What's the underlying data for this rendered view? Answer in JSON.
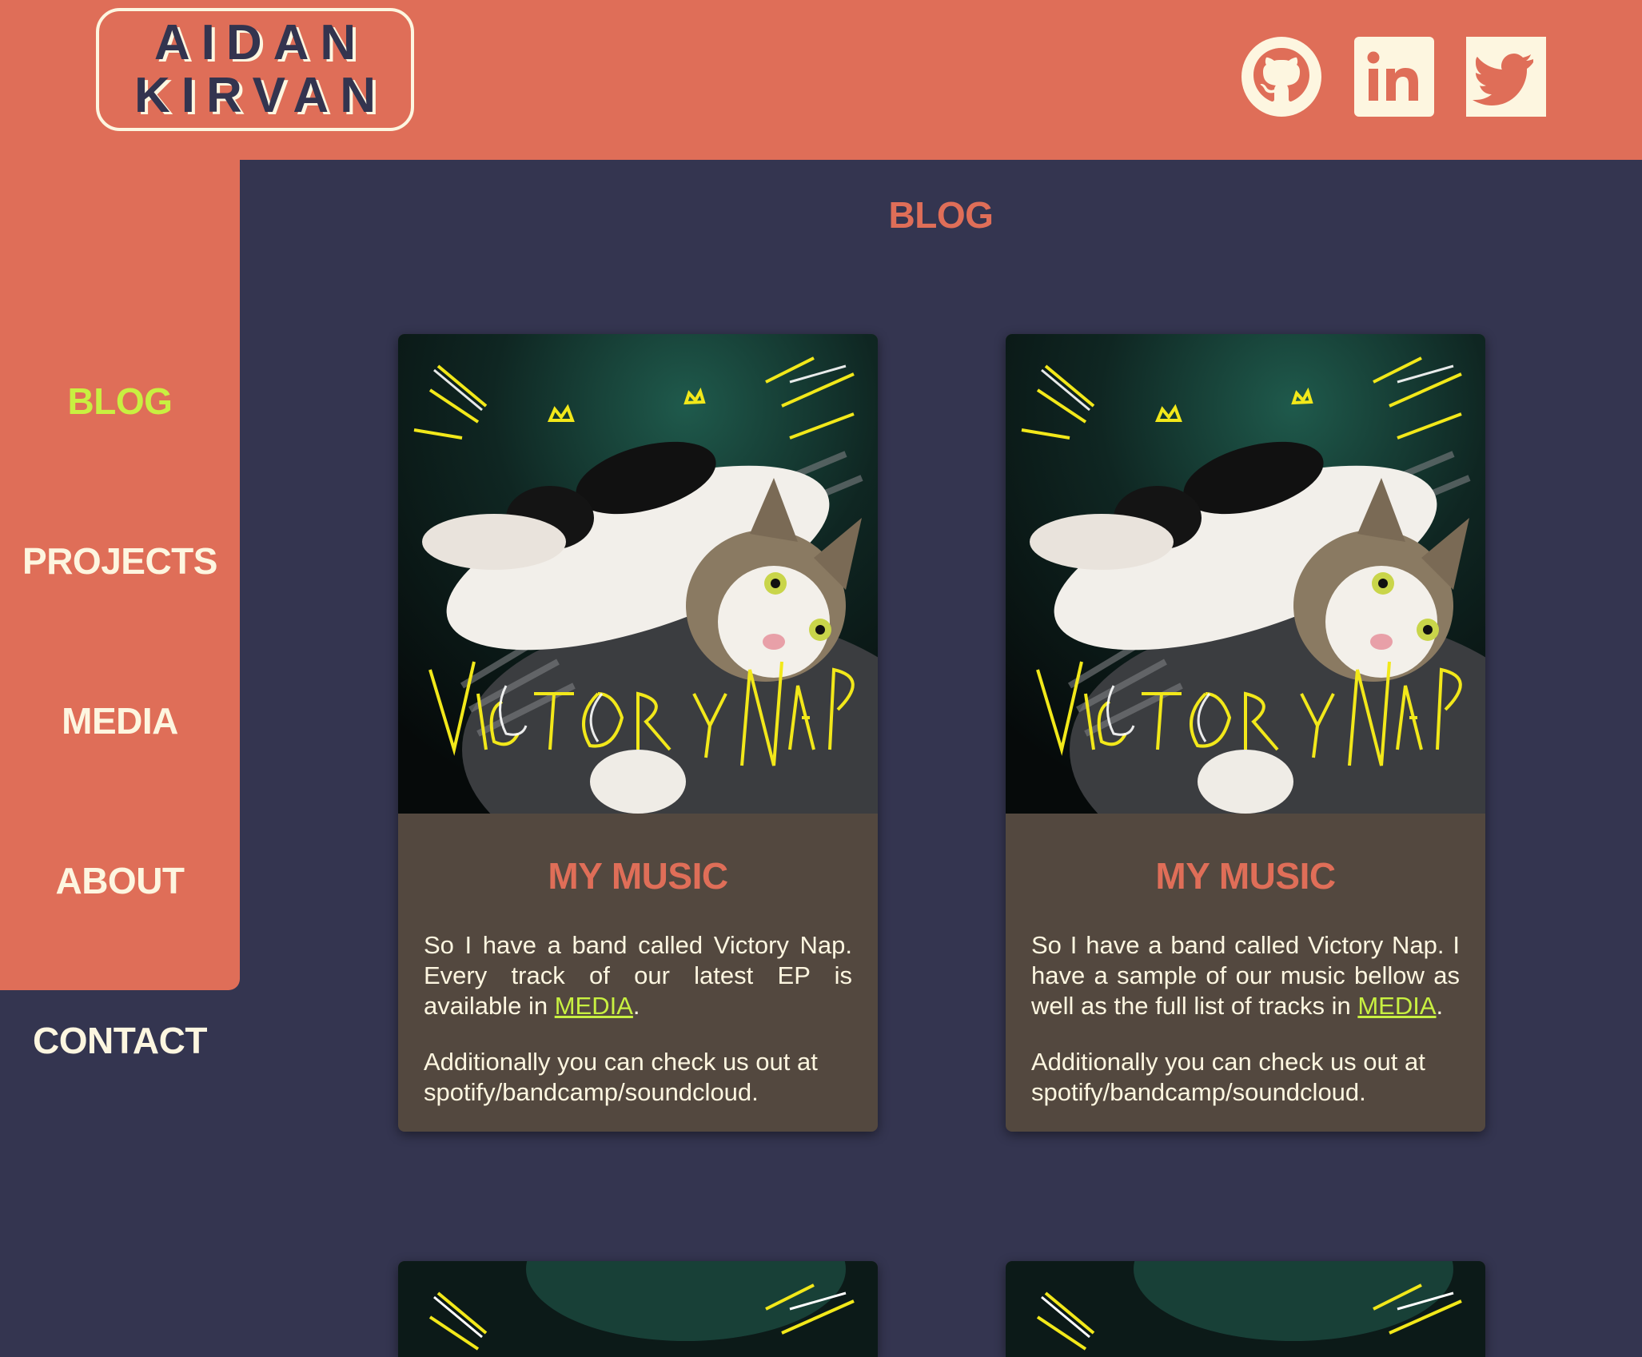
{
  "header": {
    "logo_line1": "AIDAN",
    "logo_line2": "KIRVAN",
    "social": [
      {
        "icon": "github-icon"
      },
      {
        "icon": "linkedin-icon",
        "glyph": "in"
      },
      {
        "icon": "twitter-icon"
      }
    ]
  },
  "sidebar": {
    "items": [
      {
        "label": "BLOG",
        "active": true
      },
      {
        "label": "PROJECTS"
      },
      {
        "label": "MEDIA"
      },
      {
        "label": "ABOUT"
      },
      {
        "label": "CONTACT"
      }
    ]
  },
  "main": {
    "title": "BLOG",
    "cards": [
      {
        "image_text": "VICTORY NAP",
        "title": "MY MUSIC",
        "p1_before": "So I have a band called Victory Nap. Every track of our latest EP is available in ",
        "p1_link": "MEDIA",
        "p1_after": ".",
        "p2": "Additionally you can check us out at spotify/bandcamp/soundcloud."
      },
      {
        "image_text": "VICTORY NAP",
        "title": "MY MUSIC",
        "p1_before": "So I have a band called Victory Nap. I have a sample of our music bellow as well as the full list of tracks in ",
        "p1_link": "MEDIA",
        "p1_after": ".",
        "p2": "Additionally you can check us out at spotify/bandcamp/soundcloud."
      }
    ]
  },
  "colors": {
    "header_bg": "#df6e58",
    "page_bg": "#343550",
    "card_bg": "#53483f",
    "accent_green": "#c8f041",
    "cream": "#fdf6e0"
  }
}
